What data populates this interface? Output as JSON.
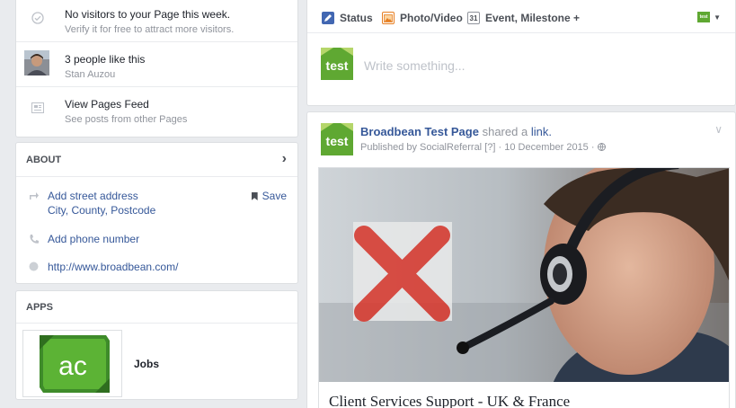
{
  "left_top": {
    "items": [
      {
        "title": "No visitors to your Page this week.",
        "subtitle": "Verify it for free to attract more visitors.",
        "icon": "check-circle-icon"
      },
      {
        "title": "3 people like this",
        "subtitle": "Stan Auzou",
        "icon": "avatar"
      },
      {
        "title": "View Pages Feed",
        "subtitle": "See posts from other Pages",
        "icon": "feed-icon"
      }
    ]
  },
  "about": {
    "title": "ABOUT",
    "address_line1": "Add street address",
    "address_line2": "City, County, Postcode",
    "save_label": "Save",
    "phone": "Add phone number",
    "website": "http://www.broadbean.com/"
  },
  "apps": {
    "title": "APPS",
    "app_name": "Jobs",
    "app_logo_text": "ac"
  },
  "composer": {
    "tab_status": "Status",
    "tab_photo": "Photo/Video",
    "tab_event": "Event, Milestone +",
    "calendar_day": "31",
    "placeholder": "Write something...",
    "logo_text": "test"
  },
  "post": {
    "page_name": "Broadbean Test Page",
    "shared_text": "shared a",
    "link_text": "link.",
    "published_by": "Published by SocialReferral",
    "help": "[?]",
    "date": "10 December 2015",
    "caption": "Client Services Support - UK & France",
    "logo_text": "test"
  },
  "colors": {
    "link_blue": "#365899",
    "brand_green": "#5fa832",
    "bg": "#e9ebee"
  }
}
